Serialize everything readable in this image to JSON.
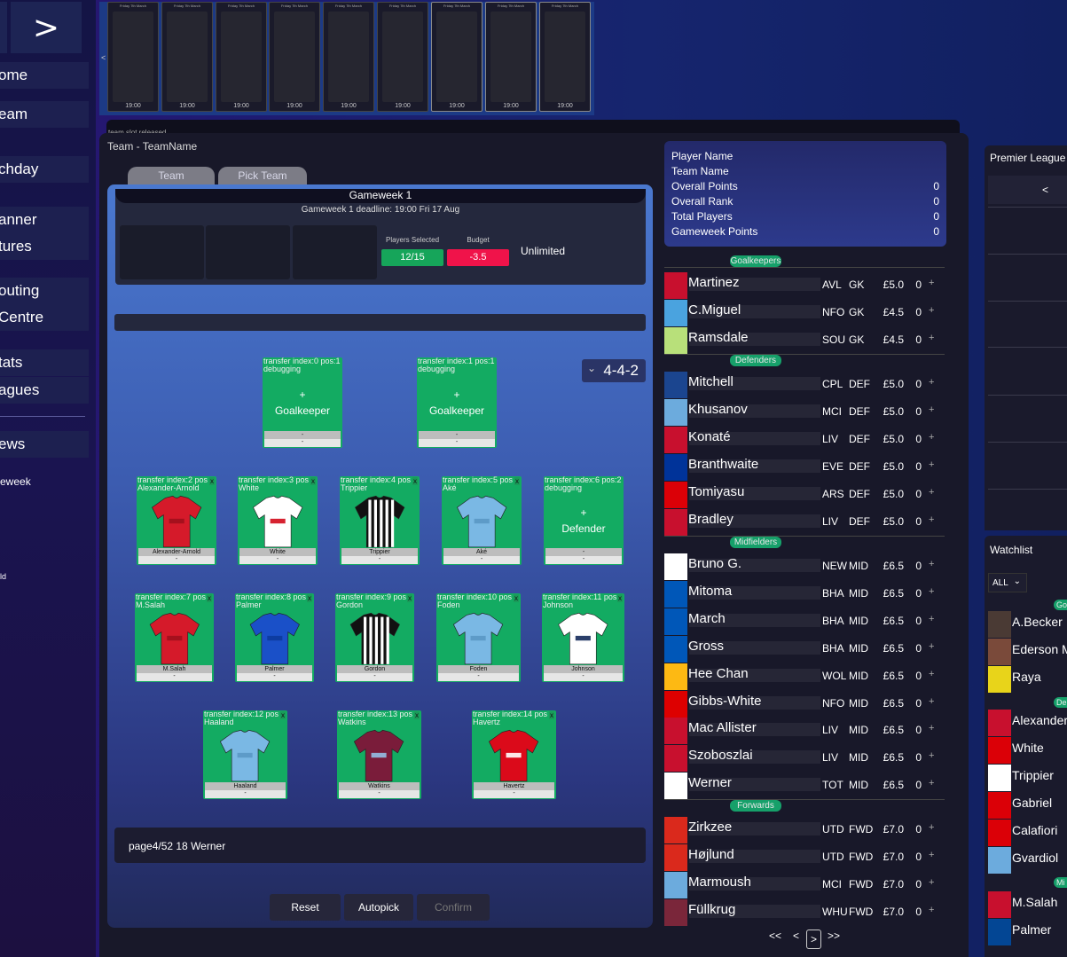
{
  "sidebar": {
    "toggle_label": ">",
    "items": [
      {
        "label": "ome"
      },
      {
        "label": "eam"
      },
      {
        "label": "chday"
      },
      {
        "label": "anner"
      },
      {
        "label": "tures"
      },
      {
        "label": "outing"
      },
      {
        "label": " Centre"
      },
      {
        "label": "tats"
      },
      {
        "label": "agues"
      },
      {
        "label": "ews"
      }
    ],
    "small_1": "eweek",
    "small_2": "ld"
  },
  "strip": {
    "left_arrow": "<",
    "cards": [
      {
        "head": "Friday 7th March",
        "time": "19:00"
      },
      {
        "head": "Friday 7th March",
        "time": "19:00"
      },
      {
        "head": "Friday 7th March",
        "time": "19:00"
      },
      {
        "head": "Friday 7th March",
        "time": "19:00"
      },
      {
        "head": "Friday 7th March",
        "time": "19:00"
      },
      {
        "head": "Friday 7th March",
        "time": "19:00"
      },
      {
        "head": "Friday 7th March",
        "time": "19:00"
      },
      {
        "head": "Friday 7th March",
        "time": "19:00"
      },
      {
        "head": "Friday 7th March",
        "time": "19:00"
      }
    ]
  },
  "notice": "team slot released",
  "team": {
    "title": "Team - TeamName",
    "tabs": [
      "Team",
      "Pick Team"
    ],
    "gameweek": "Gameweek 1",
    "deadline": "Gameweek 1 deadline: 19:00 Fri 17 Aug",
    "players_selected_label": "Players Selected",
    "players_selected": "12/15",
    "budget_label": "Budget",
    "budget": "-3.5",
    "transfers": "Unlimited",
    "formation": "4-4-2",
    "page_text": "page4/52 18 Werner",
    "buttons": {
      "reset": "Reset",
      "autopick": "Autopick",
      "confirm": "Confirm"
    }
  },
  "pitch_cards": [
    {
      "tag": "transfer index:0 pos:1",
      "sub": "debugging",
      "empty": true,
      "pos": "Goalkeeper",
      "name": "-",
      "foot": "-"
    },
    {
      "tag": "transfer index:1 pos:1",
      "sub": "debugging",
      "empty": true,
      "pos": "Goalkeeper",
      "name": "-",
      "foot": "-"
    },
    {
      "tag": "transfer index:2 pos",
      "sub": "Alexander-Arnold",
      "name": "Alexander-Arnold",
      "foot": "-"
    },
    {
      "tag": "transfer index:3 pos",
      "sub": "White",
      "name": "White",
      "foot": "-"
    },
    {
      "tag": "transfer index:4 pos",
      "sub": "Trippier",
      "name": "Trippier",
      "foot": "-"
    },
    {
      "tag": "transfer index:5 pos",
      "sub": "Aké",
      "name": "Aké",
      "foot": "-"
    },
    {
      "tag": "transfer index:6 pos:2",
      "sub": "debugging",
      "empty": true,
      "pos": "Defender",
      "name": "-",
      "foot": "-"
    },
    {
      "tag": "transfer index:7 pos",
      "sub": "M.Salah",
      "name": "M.Salah",
      "foot": "-"
    },
    {
      "tag": "transfer index:8 pos",
      "sub": "Palmer",
      "name": "Palmer",
      "foot": "-"
    },
    {
      "tag": "transfer index:9 pos",
      "sub": "Gordon",
      "name": "Gordon",
      "foot": "-"
    },
    {
      "tag": "transfer index:10 pos",
      "sub": "Foden",
      "name": "Foden",
      "foot": "-"
    },
    {
      "tag": "transfer index:11 pos",
      "sub": "Johnson",
      "name": "Johnson",
      "foot": "-"
    },
    {
      "tag": "transfer index:12 pos",
      "sub": "Haaland",
      "name": "Haaland",
      "foot": "-"
    },
    {
      "tag": "transfer index:13 pos",
      "sub": "Watkins",
      "name": "Watkins",
      "foot": "-"
    },
    {
      "tag": "transfer index:14 pos",
      "sub": "Havertz",
      "name": "Havertz",
      "foot": "-"
    }
  ],
  "plus": "+",
  "remove": "x",
  "summary": {
    "rows": [
      {
        "label": "Player Name",
        "value": ""
      },
      {
        "label": "Team Name",
        "value": ""
      },
      {
        "label": "Overall Points",
        "value": "0"
      },
      {
        "label": "Overall Rank",
        "value": "0"
      },
      {
        "label": "Total Players",
        "value": "0"
      },
      {
        "label": "Gameweek Points",
        "value": "0"
      }
    ]
  },
  "player_list": {
    "sections": {
      "gk": "Goalkeepers",
      "def": "Defenders",
      "mid": "Midfielders",
      "fwd": "Forwards"
    },
    "add": "+",
    "rows": [
      {
        "name": "Martinez",
        "team": "AVL",
        "pos": "GK",
        "price": "£5.0",
        "pts": "0",
        "kit": "#c8102e"
      },
      {
        "name": "C.Miguel",
        "team": "NFO",
        "pos": "GK",
        "price": "£4.5",
        "pts": "0",
        "kit": "#4aa3df"
      },
      {
        "name": "Ramsdale",
        "team": "SOU",
        "pos": "GK",
        "price": "£4.5",
        "pts": "0",
        "kit": "#b8e07a"
      },
      {
        "name": "Mitchell",
        "team": "CPL",
        "pos": "DEF",
        "price": "£5.0",
        "pts": "0",
        "kit": "#1b458f"
      },
      {
        "name": "Khusanov",
        "team": "MCI",
        "pos": "DEF",
        "price": "£5.0",
        "pts": "0",
        "kit": "#6cabdd"
      },
      {
        "name": "Konaté",
        "team": "LIV",
        "pos": "DEF",
        "price": "£5.0",
        "pts": "0",
        "kit": "#c8102e"
      },
      {
        "name": "Branthwaite",
        "team": "EVE",
        "pos": "DEF",
        "price": "£5.0",
        "pts": "0",
        "kit": "#003399"
      },
      {
        "name": "Tomiyasu",
        "team": "ARS",
        "pos": "DEF",
        "price": "£5.0",
        "pts": "0",
        "kit": "#db0007"
      },
      {
        "name": "Bradley",
        "team": "LIV",
        "pos": "DEF",
        "price": "£5.0",
        "pts": "0",
        "kit": "#c8102e"
      },
      {
        "name": "Bruno G.",
        "team": "NEW",
        "pos": "MID",
        "price": "£6.5",
        "pts": "0",
        "kit": "#ffffff"
      },
      {
        "name": "Mitoma",
        "team": "BHA",
        "pos": "MID",
        "price": "£6.5",
        "pts": "0",
        "kit": "#0057b8"
      },
      {
        "name": "March",
        "team": "BHA",
        "pos": "MID",
        "price": "£6.5",
        "pts": "0",
        "kit": "#0057b8"
      },
      {
        "name": "Gross",
        "team": "BHA",
        "pos": "MID",
        "price": "£6.5",
        "pts": "0",
        "kit": "#0057b8"
      },
      {
        "name": "Hee Chan",
        "team": "WOL",
        "pos": "MID",
        "price": "£6.5",
        "pts": "0",
        "kit": "#fdb913"
      },
      {
        "name": "Gibbs-White",
        "team": "NFO",
        "pos": "MID",
        "price": "£6.5",
        "pts": "0",
        "kit": "#dd0000"
      },
      {
        "name": "Mac Allister",
        "team": "LIV",
        "pos": "MID",
        "price": "£6.5",
        "pts": "0",
        "kit": "#c8102e"
      },
      {
        "name": "Szoboszlai",
        "team": "LIV",
        "pos": "MID",
        "price": "£6.5",
        "pts": "0",
        "kit": "#c8102e"
      },
      {
        "name": "Werner",
        "team": "TOT",
        "pos": "MID",
        "price": "£6.5",
        "pts": "0",
        "kit": "#ffffff"
      },
      {
        "name": "Zirkzee",
        "team": "UTD",
        "pos": "FWD",
        "price": "£7.0",
        "pts": "0",
        "kit": "#da291c"
      },
      {
        "name": "Højlund",
        "team": "UTD",
        "pos": "FWD",
        "price": "£7.0",
        "pts": "0",
        "kit": "#da291c"
      },
      {
        "name": "Marmoush",
        "team": "MCI",
        "pos": "FWD",
        "price": "£7.0",
        "pts": "0",
        "kit": "#6cabdd"
      },
      {
        "name": "Füllkrug",
        "team": "WHU",
        "pos": "FWD",
        "price": "£7.0",
        "pts": "0",
        "kit": "#7a263a"
      }
    ],
    "pager": {
      "first": "<<",
      "prev": "<",
      "current": ">",
      "last": ">>"
    }
  },
  "premier_league": {
    "title": "Premier League",
    "nav": "<"
  },
  "watchlist": {
    "title": "Watchlist",
    "filter": "ALL",
    "sections": {
      "gk": "Go",
      "def": "De",
      "mid": "Mi"
    },
    "rows": [
      {
        "name": "A.Becker",
        "kit": "#4a3a34"
      },
      {
        "name": "Ederson M",
        "kit": "#7a4a3a"
      },
      {
        "name": "Raya",
        "kit": "#e8d41a"
      },
      {
        "name": "Alexander",
        "kit": "#c8102e"
      },
      {
        "name": "White",
        "kit": "#db0007"
      },
      {
        "name": "Trippier",
        "kit": "#ffffff"
      },
      {
        "name": "Gabriel",
        "kit": "#db0007"
      },
      {
        "name": "Calafiori",
        "kit": "#db0007"
      },
      {
        "name": "Gvardiol",
        "kit": "#6cabdd"
      },
      {
        "name": "M.Salah",
        "kit": "#c8102e"
      },
      {
        "name": "Palmer",
        "kit": "#034694"
      }
    ]
  },
  "colors": {
    "accent_green": "#13ab62",
    "budget_red": "#f0134a",
    "selected_green": "#16a55a"
  }
}
